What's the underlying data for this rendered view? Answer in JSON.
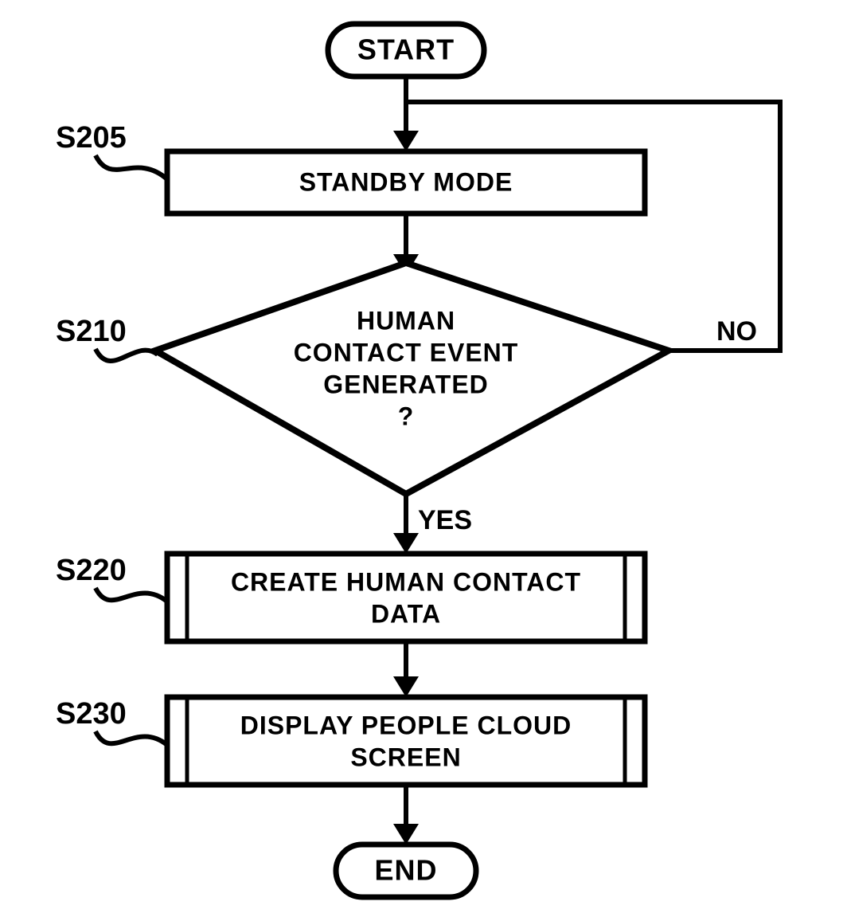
{
  "flowchart": {
    "start": "START",
    "end": "END",
    "steps": {
      "s205": {
        "id": "S205",
        "label": "STANDBY MODE"
      },
      "s210": {
        "id": "S210",
        "line1": "HUMAN",
        "line2": "CONTACT EVENT",
        "line3": "GENERATED",
        "line4": "?"
      },
      "s220": {
        "id": "S220",
        "line1": "CREATE HUMAN CONTACT",
        "line2": "DATA"
      },
      "s230": {
        "id": "S230",
        "line1": "DISPLAY PEOPLE CLOUD",
        "line2": "SCREEN"
      }
    },
    "branches": {
      "yes": "YES",
      "no": "NO"
    }
  }
}
